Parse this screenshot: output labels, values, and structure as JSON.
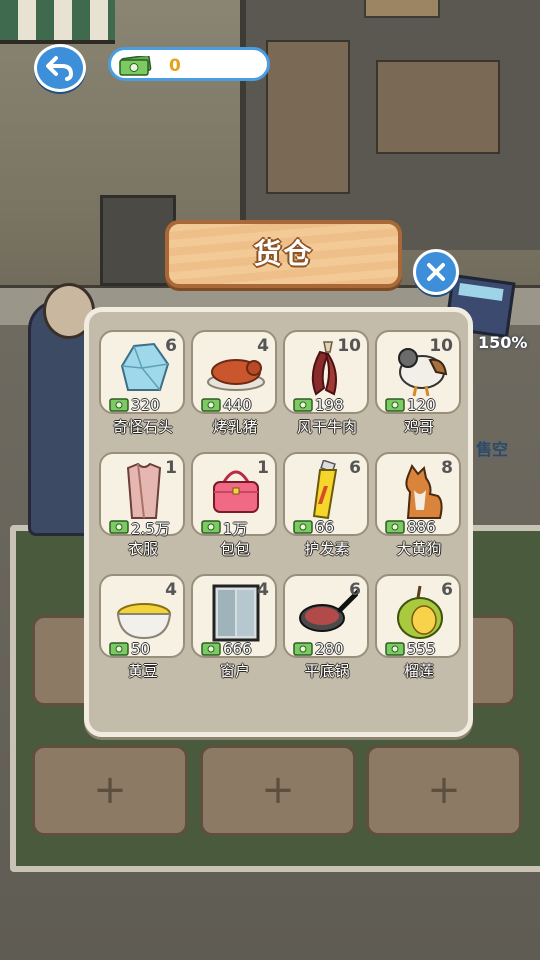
{
  "hud": {
    "money_value": "0"
  },
  "warehouse": {
    "title": "货仓",
    "items": [
      {
        "name": "奇怪石头",
        "count": "6",
        "price": "320",
        "icon": "crystal-rock-icon"
      },
      {
        "name": "烤乳猪",
        "count": "4",
        "price": "440",
        "icon": "roast-pig-icon"
      },
      {
        "name": "风干牛肉",
        "count": "10",
        "price": "198",
        "icon": "dried-beef-icon"
      },
      {
        "name": "鸡哥",
        "count": "10",
        "price": "120",
        "icon": "chicken-icon"
      },
      {
        "name": "衣服",
        "count": "1",
        "price": "2.5万",
        "icon": "clothes-icon"
      },
      {
        "name": "包包",
        "count": "1",
        "price": "1万",
        "icon": "handbag-icon"
      },
      {
        "name": "护发素",
        "count": "6",
        "price": "66",
        "icon": "conditioner-icon"
      },
      {
        "name": "大黄狗",
        "count": "8",
        "price": "886",
        "icon": "yellow-dog-icon"
      },
      {
        "name": "黄豆",
        "count": "4",
        "price": "50",
        "icon": "soybean-bowl-icon"
      },
      {
        "name": "窗户",
        "count": "4",
        "price": "666",
        "icon": "window-icon"
      },
      {
        "name": "平底锅",
        "count": "6",
        "price": "280",
        "icon": "frying-pan-icon"
      },
      {
        "name": "榴莲",
        "count": "6",
        "price": "555",
        "icon": "durian-icon"
      }
    ]
  },
  "background": {
    "percent_text": "150%",
    "empty_text": "售空",
    "slot_plus": "+"
  },
  "colors": {
    "button_blue": "#3d8fd9",
    "panel_bg": "#c4bcab",
    "plank": "#f3c996",
    "money_gold": "#e6a21a"
  }
}
